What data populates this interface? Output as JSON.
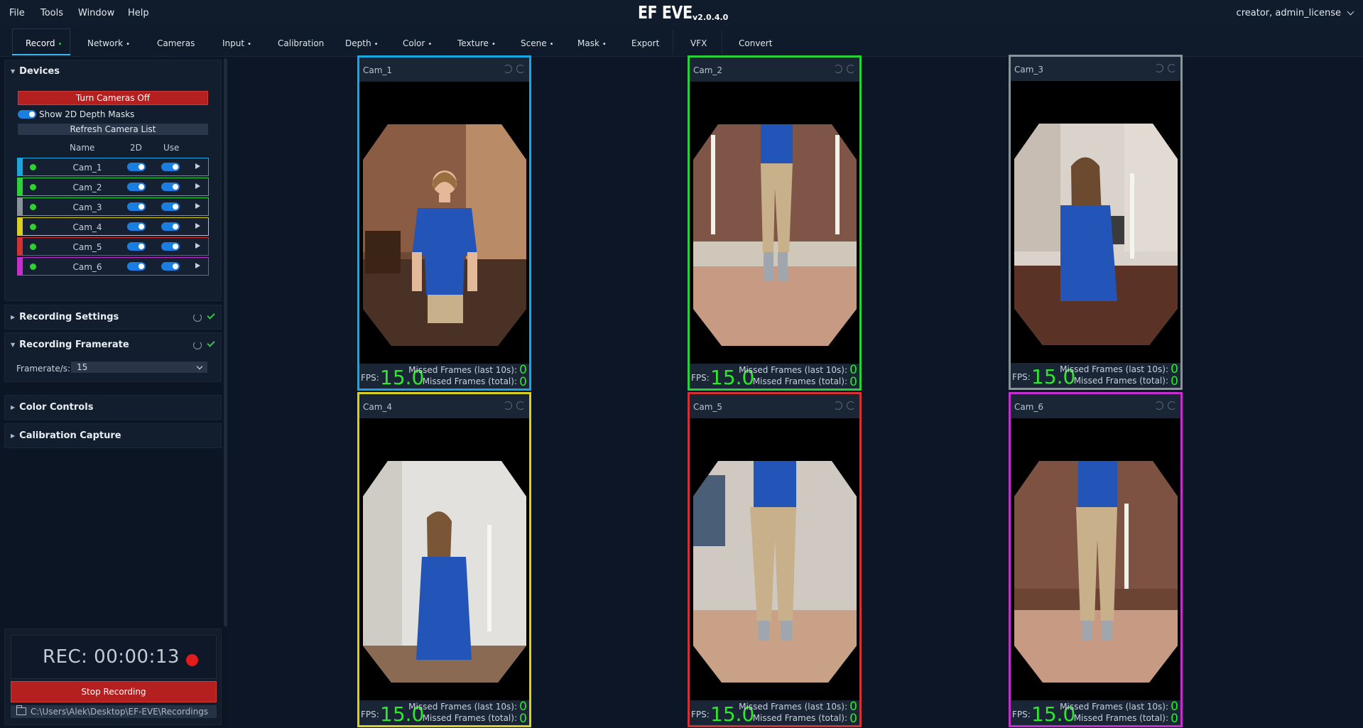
{
  "menu": {
    "file": "File",
    "tools": "Tools",
    "window": "Window",
    "help": "Help"
  },
  "app": {
    "name": "EF EVE",
    "tm": "™",
    "version": "v2.0.4.0"
  },
  "user": "creator, admin_license",
  "tabs": [
    {
      "label": "Record",
      "dot": "•"
    },
    {
      "label": "Network",
      "dot": "•"
    },
    {
      "label": "Cameras",
      "dot": ""
    },
    {
      "label": "Input",
      "dot": "•"
    },
    {
      "label": "Calibration",
      "dot": ""
    },
    {
      "label": "Depth",
      "dot": "•"
    },
    {
      "label": "Color",
      "dot": "•"
    },
    {
      "label": "Texture",
      "dot": "•"
    },
    {
      "label": "Scene",
      "dot": "•"
    },
    {
      "label": "Mask",
      "dot": "•"
    },
    {
      "label": "Export",
      "dot": ""
    },
    {
      "label": "VFX",
      "dot": ""
    },
    {
      "label": "Convert",
      "dot": ""
    }
  ],
  "devices": {
    "title": "Devices",
    "turn_off": "Turn Cameras Off",
    "show_masks": "Show 2D Depth Masks",
    "refresh": "Refresh Camera List",
    "col_name": "Name",
    "col_2d": "2D",
    "col_use": "Use",
    "cameras": [
      {
        "name": "Cam_1",
        "color": "#1aa7e0"
      },
      {
        "name": "Cam_2",
        "color": "#2bd13a"
      },
      {
        "name": "Cam_3",
        "color": "#8a939c"
      },
      {
        "name": "Cam_4",
        "color": "#d9cf24"
      },
      {
        "name": "Cam_5",
        "color": "#d33232"
      },
      {
        "name": "Cam_6",
        "color": "#c62ed0"
      }
    ]
  },
  "sections": {
    "recording_settings": "Recording Settings",
    "recording_framerate": "Recording Framerate",
    "framerate_label": "Framerate/s:",
    "framerate_value": "15",
    "color_controls": "Color Controls",
    "calibration_capture": "Calibration Capture"
  },
  "recording": {
    "time": "REC: 00:00:13",
    "stop": "Stop Recording",
    "path": "C:\\Users\\Alek\\Desktop\\EF-EVE\\Recordings"
  },
  "views": [
    {
      "name": "Cam_1",
      "fps_label": "FPS:",
      "fps": "15.0",
      "missed_last_label": "Missed Frames (last 10s):",
      "missed_last": "0",
      "missed_total_label": "Missed Frames (total):",
      "missed_total": "0"
    },
    {
      "name": "Cam_2",
      "fps_label": "FPS:",
      "fps": "15.0",
      "missed_last_label": "Missed Frames (last 10s):",
      "missed_last": "0",
      "missed_total_label": "Missed Frames (total):",
      "missed_total": "0"
    },
    {
      "name": "Cam_3",
      "fps_label": "FPS:",
      "fps": "15.0",
      "missed_last_label": "Missed Frames (last 10s):",
      "missed_last": "0",
      "missed_total_label": "Missed Frames (total):",
      "missed_total": "0"
    },
    {
      "name": "Cam_4",
      "fps_label": "FPS:",
      "fps": "15.0",
      "missed_last_label": "Missed Frames (last 10s):",
      "missed_last": "0",
      "missed_total_label": "Missed Frames (total):",
      "missed_total": "0"
    },
    {
      "name": "Cam_5",
      "fps_label": "FPS:",
      "fps": "15.0",
      "missed_last_label": "Missed Frames (last 10s):",
      "missed_last": "0",
      "missed_total_label": "Missed Frames (total):",
      "missed_total": "0"
    },
    {
      "name": "Cam_6",
      "fps_label": "FPS:",
      "fps": "15.0",
      "missed_last_label": "Missed Frames (last 10s):",
      "missed_last": "0",
      "missed_total_label": "Missed Frames (total):",
      "missed_total": "0"
    }
  ]
}
